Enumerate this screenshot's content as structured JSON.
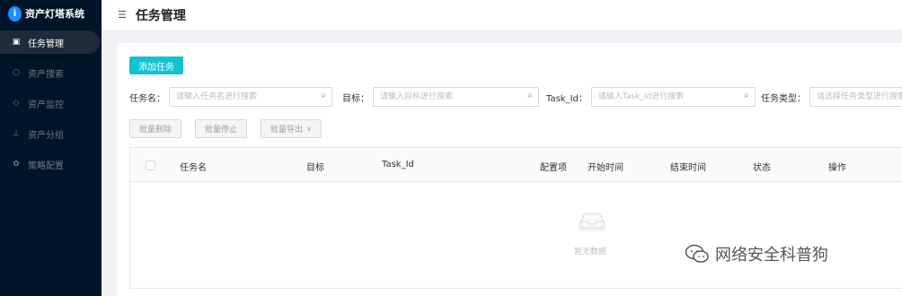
{
  "app": {
    "title": "资产灯塔系统",
    "logo_glyph": "i"
  },
  "sidebar": {
    "items": [
      {
        "label": "任务管理",
        "icon": "task-icon",
        "glyph": "▣",
        "active": true
      },
      {
        "label": "资产搜索",
        "icon": "search-icon",
        "glyph": "○",
        "active": false
      },
      {
        "label": "资产监控",
        "icon": "shield-icon",
        "glyph": "◇",
        "active": false
      },
      {
        "label": "资产分组",
        "icon": "cluster-icon",
        "glyph": "⊥",
        "active": false
      },
      {
        "label": "策略配置",
        "icon": "gear-icon",
        "glyph": "✿",
        "active": false
      }
    ]
  },
  "header": {
    "title": "任务管理",
    "collapse_glyph": "☰"
  },
  "toolbar": {
    "add_task_label": "添加任务"
  },
  "filters": {
    "task_name": {
      "label": "任务名：",
      "placeholder": "请输入任务名进行搜索"
    },
    "target": {
      "label": "目标：",
      "placeholder": "请输入目标进行搜索"
    },
    "task_id": {
      "label": "Task_Id：",
      "placeholder": "请输入Task_Id进行搜索"
    },
    "task_type": {
      "label": "任务类型：",
      "placeholder": "请选择任务类型进行搜索"
    }
  },
  "bulk_actions": {
    "delete_label": "批量删除",
    "stop_label": "批量停止",
    "export_label": "批量导出"
  },
  "table": {
    "columns": [
      "任务名",
      "目标",
      "Task_Id",
      "配置项",
      "开始时间",
      "结束时间",
      "状态",
      "操作"
    ],
    "empty_text": "暂无数据"
  },
  "watermark": {
    "text": "网络安全科普狗"
  },
  "colors": {
    "sidebar_bg": "#001529",
    "primary": "#13c2d0",
    "accent": "#1890ff"
  }
}
